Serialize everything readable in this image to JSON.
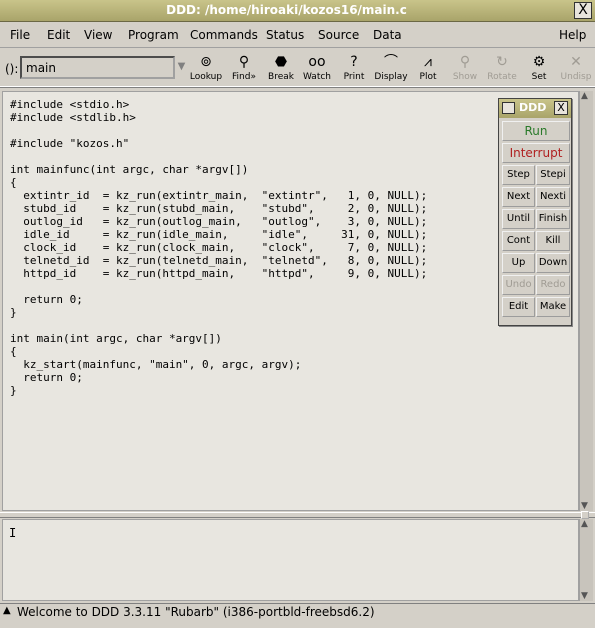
{
  "window": {
    "title": "DDD: /home/hiroaki/kozos16/main.c",
    "close": "X"
  },
  "menubar": {
    "items": [
      "File",
      "Edit",
      "View",
      "Program",
      "Commands",
      "Status",
      "Source",
      "Data"
    ],
    "help": "Help"
  },
  "toolbar": {
    "arg_label": "():",
    "arg_value": "main",
    "tools": [
      {
        "label": "Lookup",
        "icon": "lookup-icon",
        "glyph": "⊚"
      },
      {
        "label": "Find»",
        "icon": "binoculars-icon",
        "glyph": "⚲"
      },
      {
        "label": "Break",
        "icon": "stop-sign-icon",
        "glyph": "⬣"
      },
      {
        "label": "Watch",
        "icon": "eyes-icon",
        "glyph": "oo"
      },
      {
        "label": "Print",
        "icon": "question-icon",
        "glyph": "?"
      },
      {
        "label": "Display",
        "icon": "display-icon",
        "glyph": "⌒"
      },
      {
        "label": "Plot",
        "icon": "plot-icon",
        "glyph": "⩘"
      },
      {
        "label": "Show",
        "icon": "magnifier-icon",
        "glyph": "⚲"
      },
      {
        "label": "Rotate",
        "icon": "rotate-icon",
        "glyph": "↻"
      },
      {
        "label": "Set",
        "icon": "set-icon",
        "glyph": "⚙"
      },
      {
        "label": "Undisp",
        "icon": "undisplay-icon",
        "glyph": "✕"
      }
    ]
  },
  "source": {
    "code": "#include <stdio.h>\n#include <stdlib.h>\n\n#include \"kozos.h\"\n\nint mainfunc(int argc, char *argv[])\n{\n  extintr_id  = kz_run(extintr_main,  \"extintr\",   1, 0, NULL);\n  stubd_id    = kz_run(stubd_main,    \"stubd\",     2, 0, NULL);\n  outlog_id   = kz_run(outlog_main,   \"outlog\",    3, 0, NULL);\n  idle_id     = kz_run(idle_main,     \"idle\",     31, 0, NULL);\n  clock_id    = kz_run(clock_main,    \"clock\",     7, 0, NULL);\n  telnetd_id  = kz_run(telnetd_main,  \"telnetd\",   8, 0, NULL);\n  httpd_id    = kz_run(httpd_main,    \"httpd\",     9, 0, NULL);\n\n  return 0;\n}\n\nint main(int argc, char *argv[])\n{\n  kz_start(mainfunc, \"main\", 0, argc, argv);\n  return 0;\n}"
  },
  "command_tool": {
    "title": "DDD",
    "run": "Run",
    "interrupt": "Interrupt",
    "buttons": [
      [
        "Step",
        "Stepi"
      ],
      [
        "Next",
        "Nexti"
      ],
      [
        "Until",
        "Finish"
      ],
      [
        "Cont",
        "Kill"
      ],
      [
        "Up",
        "Down"
      ],
      [
        "Undo",
        "Redo"
      ],
      [
        "Edit",
        "Make"
      ]
    ],
    "colors": {
      "run": "#2a7a2a",
      "interrupt": "#b02020"
    }
  },
  "console": {
    "cursor": "I"
  },
  "status": {
    "text": "Welcome to DDD 3.3.11 \"Rubarb\" (i386-portbld-freebsd6.2)"
  }
}
